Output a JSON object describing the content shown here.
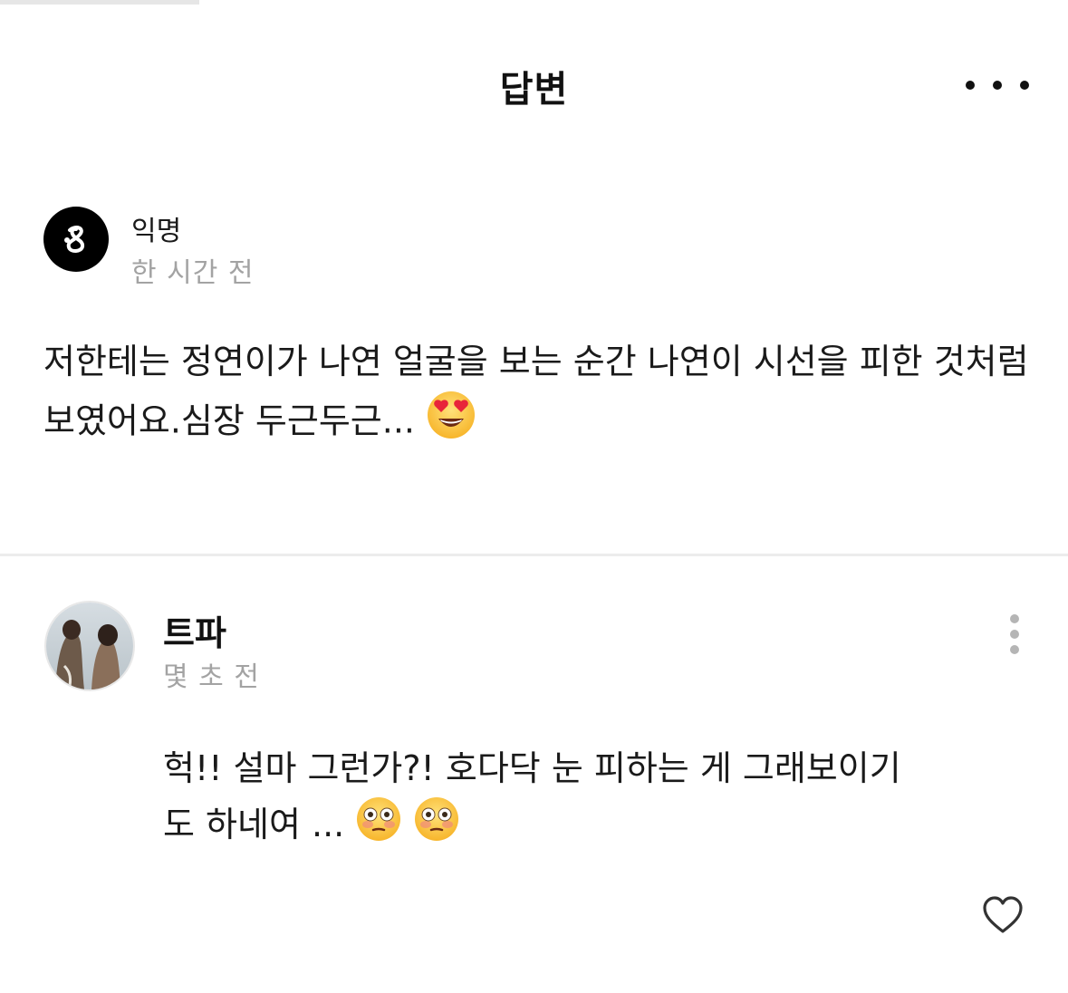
{
  "header": {
    "title": "답변",
    "more_icon": "more-horizontal-icon"
  },
  "question": {
    "author": "익명",
    "time": "한 시간 전",
    "body": "저한테는 정연이가 나연 얼굴을 보는 순간 나연이 시선을 피한 것처럼 보였어요.심장 두근두근...",
    "emoji": "heart-eyes-emoji",
    "avatar_icon": "anonymous-logo-icon"
  },
  "reply": {
    "author": "트파",
    "time": "몇 초 전",
    "body": "헉!! 설마 그런가?! 호다닥 눈 피하는 게 그래보이기도 하네여 ...",
    "emojis": [
      "flushed-face-emoji",
      "flushed-face-emoji"
    ],
    "menu_icon": "more-vertical-icon",
    "like_icon": "heart-outline-icon"
  },
  "colors": {
    "text": "#1a1a1a",
    "muted": "#a3a3a3",
    "divider": "#ececec",
    "avatar_bg": "#000000"
  }
}
